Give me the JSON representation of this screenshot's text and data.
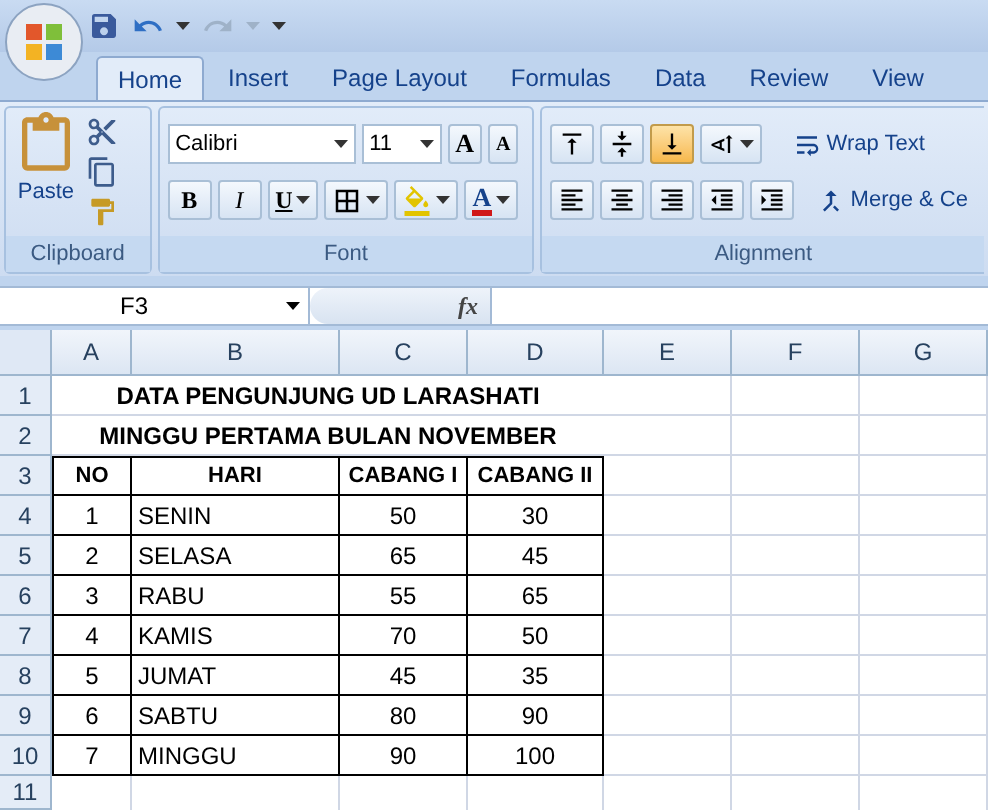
{
  "tabs": [
    {
      "label": "Home",
      "selected": true
    },
    {
      "label": "Insert",
      "selected": false
    },
    {
      "label": "Page Layout",
      "selected": false
    },
    {
      "label": "Formulas",
      "selected": false
    },
    {
      "label": "Data",
      "selected": false
    },
    {
      "label": "Review",
      "selected": false
    },
    {
      "label": "View",
      "selected": false
    }
  ],
  "clipboard": {
    "label": "Clipboard",
    "paste": "Paste"
  },
  "font": {
    "label": "Font",
    "font_name": "Calibri",
    "font_size": "11",
    "grow": "A",
    "shrink": "A",
    "bold": "B",
    "italic": "I",
    "underline": "U",
    "font_color": "A"
  },
  "alignment": {
    "label": "Alignment",
    "vertical": [
      {
        "selected": false
      },
      {
        "selected": false
      },
      {
        "selected": true
      }
    ],
    "wrap_text": "Wrap Text",
    "merge": "Merge & Ce"
  },
  "name_box": "F3",
  "formula_label": "fx",
  "columns": [
    "A",
    "B",
    "C",
    "D",
    "E",
    "F",
    "G"
  ],
  "rows": [
    {
      "kind": "title",
      "header": "1",
      "text": "DATA PENGUNJUNG UD LARASHATI"
    },
    {
      "kind": "title",
      "header": "2",
      "text": "MINGGU PERTAMA BULAN NOVEMBER"
    },
    {
      "kind": "heading",
      "header": "3",
      "cells": [
        "NO",
        "HARI",
        "CABANG I",
        "CABANG II"
      ]
    },
    {
      "kind": "data",
      "header": "4",
      "cells": [
        "1",
        "SENIN",
        "50",
        "30"
      ]
    },
    {
      "kind": "data",
      "header": "5",
      "cells": [
        "2",
        "SELASA",
        "65",
        "45"
      ]
    },
    {
      "kind": "data",
      "header": "6",
      "cells": [
        "3",
        "RABU",
        "55",
        "65"
      ]
    },
    {
      "kind": "data",
      "header": "7",
      "cells": [
        "4",
        "KAMIS",
        "70",
        "50"
      ]
    },
    {
      "kind": "data",
      "header": "8",
      "cells": [
        "5",
        "JUMAT",
        "45",
        "35"
      ]
    },
    {
      "kind": "data",
      "header": "9",
      "cells": [
        "6",
        "SABTU",
        "80",
        "90"
      ]
    },
    {
      "kind": "data",
      "header": "10",
      "cells": [
        "7",
        "MINGGU",
        "90",
        "100"
      ]
    },
    {
      "kind": "empty",
      "header": "11"
    }
  ]
}
